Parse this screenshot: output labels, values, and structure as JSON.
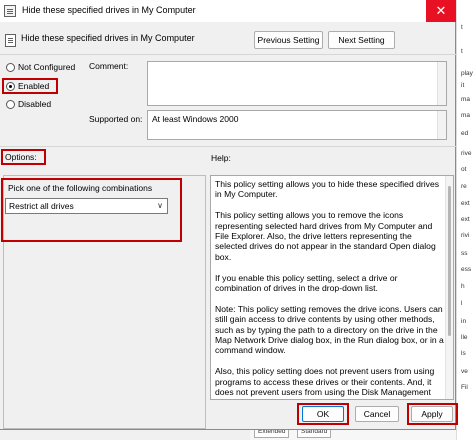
{
  "window": {
    "title": "Hide these specified drives in My Computer",
    "close_glyph": "✕"
  },
  "header": {
    "setting_name": "Hide these specified drives in My Computer",
    "previous_label": "Previous Setting",
    "next_label": "Next Setting"
  },
  "state": {
    "options": [
      {
        "label": "Not Configured",
        "checked": false
      },
      {
        "label": "Enabled",
        "checked": true
      },
      {
        "label": "Disabled",
        "checked": false
      }
    ]
  },
  "comment": {
    "label": "Comment:",
    "value": ""
  },
  "supported": {
    "label": "Supported on:",
    "value": "At least Windows 2000"
  },
  "options_section": {
    "label": "Options:",
    "pick_label": "Pick one of the following combinations",
    "selected": "Restrict all drives"
  },
  "help_section": {
    "label": "Help:",
    "paragraphs": [
      "This policy setting allows you to hide these specified drives in My Computer.",
      "This policy setting allows you to remove the icons representing selected hard drives from My Computer and File Explorer. Also, the drive letters representing the selected drives do not appear in the standard Open dialog box.",
      "If you enable this policy setting, select a drive or combination of drives in the drop-down list.",
      "Note: This policy setting removes the drive icons. Users can still gain access to drive contents by using other methods, such as by typing the path to a directory on the drive in the Map Network Drive dialog box, in the Run dialog box, or in a command window.",
      "Also, this policy setting does not prevent users from using programs to access these drives or their contents. And, it does not prevent users from using the Disk Management snap-in to view and change drive characteristics."
    ]
  },
  "footer": {
    "ok_label": "OK",
    "cancel_label": "Cancel",
    "apply_label": "Apply"
  },
  "background": {
    "strip_lines": [
      "t",
      "t",
      "play",
      "it",
      "ma",
      "ma",
      "ed",
      "rive",
      "ot",
      "re",
      "ext",
      "ext",
      "rivi",
      "ss",
      "ess",
      "h",
      "l",
      "in",
      "lle",
      "ls",
      "ve",
      "Fil"
    ],
    "tabs": [
      "Extended",
      "Standard"
    ]
  },
  "colors": {
    "highlight": "#c00000",
    "close": "#e81123",
    "accent": "#0078d4"
  }
}
